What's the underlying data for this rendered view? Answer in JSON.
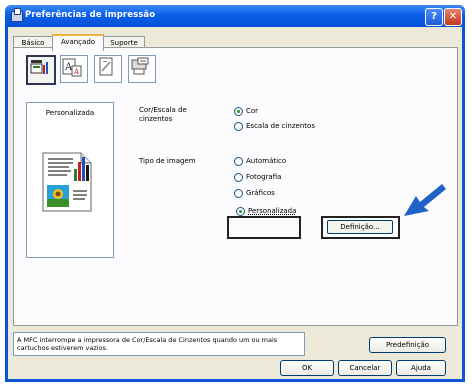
{
  "window": {
    "title": "Preferências de impressão",
    "help_button": "?",
    "close_button": "✕"
  },
  "tabs": [
    {
      "label": "Básico",
      "active": false
    },
    {
      "label": "Avançado",
      "active": true
    },
    {
      "label": "Suporte",
      "active": false
    }
  ],
  "toolbar_icons": [
    "color-mode-icon",
    "scaling-icon",
    "watermark-icon",
    "device-options-icon"
  ],
  "preview": {
    "label": "Personalizada"
  },
  "color": {
    "label": "Cor/Escala de cinzentos",
    "options": [
      {
        "label": "Cor",
        "selected": true
      },
      {
        "label": "Escala de cinzentos",
        "selected": false
      }
    ]
  },
  "image_type": {
    "label": "Tipo de imagem",
    "options": [
      {
        "label": "Automático",
        "selected": false
      },
      {
        "label": "Fotografia",
        "selected": false
      },
      {
        "label": "Gráficos",
        "selected": false
      },
      {
        "label": "Personalizada",
        "selected": true
      }
    ],
    "settings_button": "Definição..."
  },
  "message": "A MFC interrompe a impressora de Cor/Escala de Cinzentos quando um ou mais cartuchos estiverem vazios.",
  "buttons": {
    "default": "Predefinição",
    "ok": "OK",
    "cancel": "Cancelar",
    "help": "Ajuda"
  },
  "colors": {
    "titlebar": "#0553d8",
    "dialog_bg": "#ece9d8",
    "arrow": "#1f63c6",
    "radio_selected": "#21a121"
  }
}
